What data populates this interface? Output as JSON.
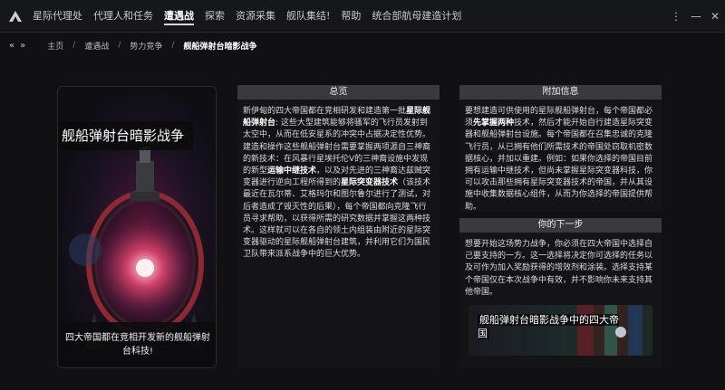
{
  "nav": {
    "items": [
      "星际代理处",
      "代理人和任务",
      "遭遇战",
      "探索",
      "资源采集",
      "舰队集结!",
      "帮助",
      "统合部航母建造计划"
    ],
    "active_index": 2
  },
  "breadcrumb": {
    "back_glyph": "«",
    "forward_glyph": "»",
    "items": [
      "主页",
      "遭遇战",
      "势力竞争",
      "舰船弹射台暗影战争"
    ]
  },
  "banner": {
    "title": "舰船弹射台暗影战争",
    "caption": "四大帝国都在竞相开发新的舰船弹射台科技!"
  },
  "overview": {
    "heading": "总览",
    "p1": "新伊甸的四大帝国都在竞相研发和建造第一批",
    "b1": "星际舰船弹射台",
    "p2": ": 这些大型建筑能够将骚军的飞行员发射到太空中，从而在低安星系的冲突中占据决定性优势。建造和操作这些舰船弹射台需要掌握两项源自三神裔的新技术：在风暴行星埃托伦V的三神裔设施中发现的新型",
    "b2": "运输中继技术",
    "p3": "，以及对先进的三神裔达兹贼突变器进行逆向工程所得到的",
    "b3": "星际突变器技术",
    "p4": "（该技术最近在瓦尔蒂、艾格玛尔和图尔鲁尔进行了测试，对后者造成了毁灭性的后果），每个帝国都向克隆飞行员寻求帮助，以获得所需的研究数据并掌握这两种技术。这样就可以在各自的领土内组装由附近的星际突变器驱动的星际舰船弹射台建筑，并利用它们为国民卫队带来派系战争中的巨大优势。"
  },
  "info": {
    "heading": "附加信息",
    "p1": "要想建造可供使用的星际舰船弹射台，每个帝国都必须",
    "b1": "先掌握两种",
    "p2": "技术，然后才能开始自行建造星际突变器和舰船弹射台设施。每个帝国都在召集忠诚的克隆飞行员，从已拥有他们所需技术的帝国处窃取机密数据核心，并加以重建。例如：如果你选择的帝国目前拥有运输中继技术，但尚未掌握星际突变器科技，你可以攻击那些拥有星际突变器技术的帝国，并从其设施中收集数据核心组件，从而为你选择的帝国提供帮助。"
  },
  "next": {
    "heading": "你的下一步",
    "text": "想要开始这场势力战争，你必须在四大帝国中选择自己要支持的一方。这一选择将决定你可选择的任务以及可作为加入奖励获得的增效剂和涂装。选择支持某个帝国仅在本次战争中有效，并不影响你未来支持其他帝国。",
    "promo_text": "舰船弹射台暗影战争中的四大帝国"
  },
  "colors": {
    "background": "#111114",
    "panel_header": "#3a3a3e",
    "accent_red": "#c2283d"
  }
}
